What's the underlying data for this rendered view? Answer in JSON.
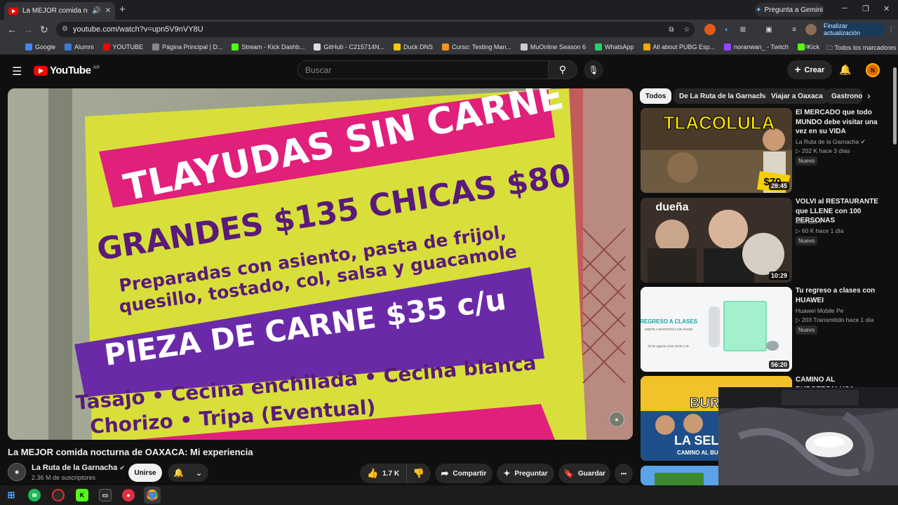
{
  "browser": {
    "tab_title": "La MEJOR comida nocturna de OAXACA: Mi experiencia",
    "gemini_label": "Pregunta a Gemini",
    "url": "youtube.com/watch?v=upn5V9nVY8U",
    "update_label": "Finalizar actualización",
    "bookmarks": [
      {
        "label": "Google",
        "color": "#4285f4"
      },
      {
        "label": "Alumni",
        "color": "#3a7bd5"
      },
      {
        "label": "YOUTUBE",
        "color": "#ff0000"
      },
      {
        "label": "Página Principal | D...",
        "color": "#888888"
      },
      {
        "label": "Stream - Kick Dashb...",
        "color": "#53fc18"
      },
      {
        "label": "GitHub - C215714N...",
        "color": "#dddddd"
      },
      {
        "label": "Duck DNS",
        "color": "#f5c518"
      },
      {
        "label": "Curso: Testing Man...",
        "color": "#f7931e"
      },
      {
        "label": "MuOnline Season 6",
        "color": "#cccccc"
      },
      {
        "label": "WhatsApp",
        "color": "#25d366"
      },
      {
        "label": "All about PUBG Esp...",
        "color": "#f2a900"
      },
      {
        "label": "noranwan_ - Twitch",
        "color": "#9146ff"
      },
      {
        "label": "Kick",
        "color": "#53fc18"
      }
    ],
    "all_bookmarks": "Todos los marcadores"
  },
  "youtube": {
    "logo_text": "YouTube",
    "country_code": "AR",
    "search_placeholder": "Buscar",
    "create_label": "Crear",
    "avatar_label": "N"
  },
  "video": {
    "sign_lines": [
      "TLAYUDAS SIN CARNE",
      "GRANDES $135   CHICAS $80",
      "Preparadas con asiento, pasta de frijol,",
      "quesillo, tostado, col, salsa y guacamole",
      "PIEZA DE CARNE $35 c/u",
      "Tasajo • Cecina enchilada • Cecina blanca",
      "Chorizo • Tripa (Eventual)"
    ],
    "title": "La MEJOR comida nocturna de OAXACA: Mi experiencia",
    "channel_name": "La Ruta de la Garnacha",
    "subscribers": "2.36 M de suscriptores",
    "join_label": "Unirse",
    "likes": "1.7 K",
    "share_label": "Compartir",
    "ask_label": "Preguntar",
    "save_label": "Guardar",
    "more_label": "•••"
  },
  "chips": [
    "Todos",
    "De La Ruta de la Garnacha",
    "Viajar a Oaxaca",
    "Gastrono"
  ],
  "recommendations": [
    {
      "title": "El MERCADO que todo MUNDO debe visitar una vez en su VIDA",
      "channel": "La Ruta de la Garnacha",
      "meta": "202 K  hace 3 días",
      "badge": "Nuevo",
      "duration": "28:45",
      "thumb_text": "TLACOLULA",
      "thumb_price": "$70"
    },
    {
      "title": "VOLVI al RESTAURANTE que LLENE con 100 PERSONAS",
      "channel": "Mernuel",
      "meta": "60 K  hace 1 día",
      "badge": "Nuevo",
      "duration": "10:29",
      "thumb_text": "dueña"
    },
    {
      "title": "Tu regreso a clases con HUAWEI",
      "channel": "Huawei Mobile Pe",
      "meta": "203  Transmitido hace 1 día",
      "badge": "Nuevo",
      "duration": "56:20",
      "thumb_text": "REGRESO A CLASES",
      "thumb_sub": "ÚNETE A NUESTRO LIVE SHOW",
      "thumb_date": "20 de agosto a las 10:00 A.M."
    },
    {
      "title": "CAMINO AL BURGERPALUSA:",
      "thumb_text": "LA SELL",
      "thumb_sub": "CAMINO AL BU",
      "thumb_top": "BUR PAL"
    }
  ],
  "colors": {
    "accent": "#ff0000",
    "bg": "#0f0f0f",
    "sign_yellow": "#d9e03a",
    "sign_pink": "#e0207a",
    "sign_purple": "#6a2aa8"
  }
}
